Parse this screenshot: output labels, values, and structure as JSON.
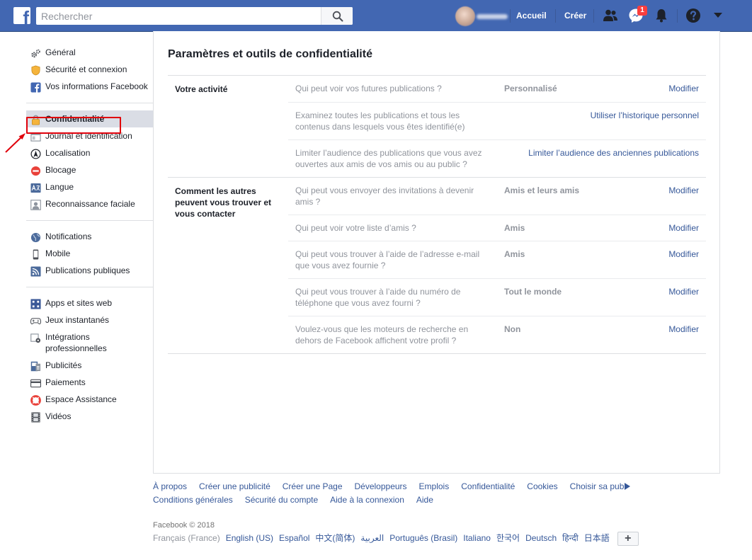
{
  "topbar": {
    "logo": "f",
    "search_placeholder": "Rechercher",
    "nav": {
      "home": "Accueil",
      "create": "Créer"
    },
    "messenger_badge": "1",
    "icons": [
      "friends-icon",
      "messenger-icon",
      "bell-icon",
      "help-icon",
      "dropdown-arrow-icon"
    ]
  },
  "sidebar": {
    "groups": [
      [
        {
          "label": "Général",
          "icon": "gears-icon"
        },
        {
          "label": "Sécurité et connexion",
          "icon": "shield-icon"
        },
        {
          "label": "Vos informations Facebook",
          "icon": "facebook-icon"
        }
      ],
      [
        {
          "label": "Confidentialité",
          "icon": "lock-icon",
          "selected": true
        },
        {
          "label": "Journal et identification",
          "icon": "timeline-icon"
        },
        {
          "label": "Localisation",
          "icon": "location-icon"
        },
        {
          "label": "Blocage",
          "icon": "block-icon"
        },
        {
          "label": "Langue",
          "icon": "language-icon"
        },
        {
          "label": "Reconnaissance faciale",
          "icon": "face-icon"
        }
      ],
      [
        {
          "label": "Notifications",
          "icon": "globe-icon"
        },
        {
          "label": "Mobile",
          "icon": "mobile-icon"
        },
        {
          "label": "Publications publiques",
          "icon": "rss-icon"
        }
      ],
      [
        {
          "label": "Apps et sites web",
          "icon": "apps-icon"
        },
        {
          "label": "Jeux instantanés",
          "icon": "gamepad-icon"
        },
        {
          "label": "Intégrations professionnelles",
          "icon": "integrations-icon"
        },
        {
          "label": "Publicités",
          "icon": "ads-icon"
        },
        {
          "label": "Paiements",
          "icon": "card-icon"
        },
        {
          "label": "Espace Assistance",
          "icon": "lifebuoy-icon"
        },
        {
          "label": "Vidéos",
          "icon": "film-icon"
        }
      ]
    ]
  },
  "main": {
    "title": "Paramètres et outils de confidentialité",
    "sections": [
      {
        "title": "Votre activité",
        "rows": [
          {
            "question": "Qui peut voir vos futures publications ?",
            "value": "Personnalisé",
            "action": "Modifier"
          },
          {
            "question": "Examinez toutes les publications et tous les contenus dans lesquels vous êtes identifié(e)",
            "value": "",
            "action": "Utiliser l’historique personnel"
          },
          {
            "question": "Limiter l’audience des publications que vous avez ouvertes aux amis de vos amis ou au public ?",
            "value": "",
            "action": "Limiter l’audience des anciennes publications"
          }
        ]
      },
      {
        "title": "Comment les autres peuvent vous trouver et vous contacter",
        "rows": [
          {
            "question": "Qui peut vous envoyer des invitations à devenir amis ?",
            "value": "Amis et leurs amis",
            "action": "Modifier"
          },
          {
            "question": "Qui peut voir votre liste d’amis ?",
            "value": "Amis",
            "action": "Modifier"
          },
          {
            "question": "Qui peut vous trouver à l’aide de l’adresse e-mail que vous avez fournie ?",
            "value": "Amis",
            "action": "Modifier"
          },
          {
            "question": "Qui peut vous trouver à l’aide du numéro de téléphone que vous avez fourni ?",
            "value": "Tout le monde",
            "action": "Modifier"
          },
          {
            "question": "Voulez-vous que les moteurs de recherche en dehors de Facebook affichent votre profil ?",
            "value": "Non",
            "action": "Modifier"
          }
        ]
      }
    ]
  },
  "footer": {
    "links_row1": [
      "À propos",
      "Créer une publicité",
      "Créer une Page",
      "Développeurs",
      "Emplois",
      "Confidentialité",
      "Cookies",
      "Choisir sa pub"
    ],
    "links_row2": [
      "Conditions générales",
      "Sécurité du compte",
      "Aide à la connexion",
      "Aide"
    ],
    "copyright": "Facebook © 2018",
    "current_language": "Français (France)",
    "languages": [
      "English (US)",
      "Español",
      "中文(简体)",
      "العربية",
      "Português (Brasil)",
      "Italiano",
      "한국어",
      "Deutsch",
      "हिन्दी",
      "日本語"
    ],
    "more_languages": "+"
  },
  "colors": {
    "topbar": "#4267b2",
    "link": "#365899",
    "muted": "#90949c",
    "selected_bg": "#dadde5",
    "highlight_outline": "#e0000b",
    "badge": "#fa3e3e"
  }
}
